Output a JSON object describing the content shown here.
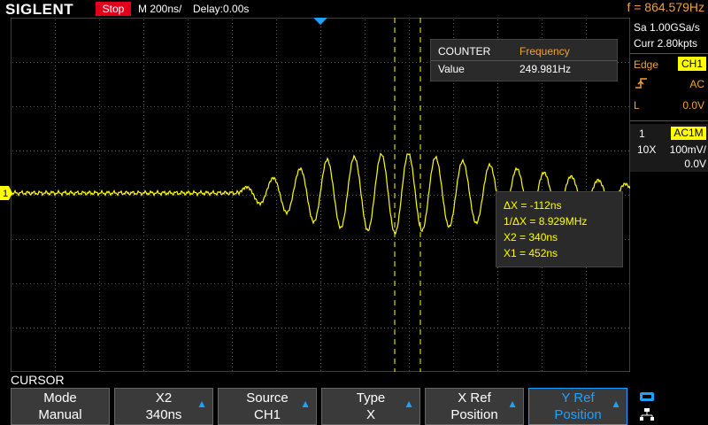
{
  "topbar": {
    "logo": "SIGLENT",
    "run_state": "Stop",
    "timebase": "M 200ns/",
    "delay": "Delay:0.00s",
    "frequency": "f = 864.579Hz"
  },
  "acquisition": {
    "sample_rate": "Sa 1.00GSa/s",
    "memory": "Curr 2.80kpts"
  },
  "trigger": {
    "type_label": "Edge",
    "source": "CH1",
    "coupling": "AC",
    "level_label": "L",
    "level": "0.0V"
  },
  "channel": {
    "number": "1",
    "coupling": "AC1M",
    "probe": "10X",
    "scale": "100mV/",
    "offset": "0.0V"
  },
  "counter": {
    "header_left": "COUNTER",
    "header_right": "Frequency",
    "row_label": "Value",
    "row_value": "249.981Hz"
  },
  "cursor": {
    "delta_x": "ΔX = -112ns",
    "inv_delta_x": "1/ΔX = 8.929MHz",
    "x2": "X2 = 340ns",
    "x1": "X1 = 452ns"
  },
  "menu": {
    "title": "CURSOR",
    "softkeys": [
      {
        "line1": "Mode",
        "line2": "Manual"
      },
      {
        "line1": "X2",
        "line2": "340ns"
      },
      {
        "line1": "Source",
        "line2": "CH1"
      },
      {
        "line1": "Type",
        "line2": "X"
      },
      {
        "line1": "X Ref",
        "line2": "Position"
      },
      {
        "line1": "Y Ref",
        "line2": "Position"
      }
    ]
  },
  "colors": {
    "trace": "#ffff00",
    "accent": "#f1a23b",
    "run_badge": "#e0001a",
    "softkey_arrow": "#1fa0ff",
    "marker": "#1fa0ff"
  },
  "icons": [
    "trigger-rising-edge-icon",
    "softkey-arrow-icon",
    "usb-icon",
    "network-icon",
    "trigger-position-marker-icon"
  ],
  "channel_marker": "1"
}
